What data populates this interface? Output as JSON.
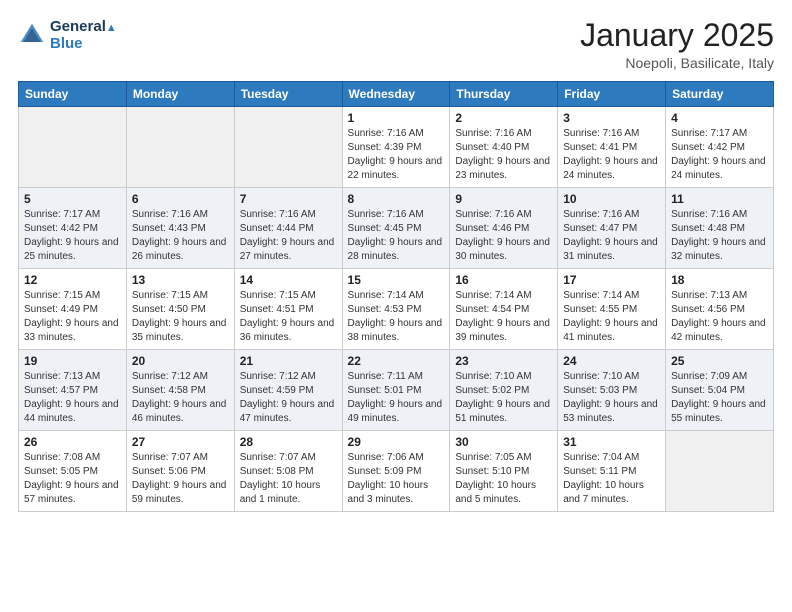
{
  "header": {
    "logo_line1": "General",
    "logo_line2": "Blue",
    "month_title": "January 2025",
    "location": "Noepoli, Basilicate, Italy"
  },
  "days_of_week": [
    "Sunday",
    "Monday",
    "Tuesday",
    "Wednesday",
    "Thursday",
    "Friday",
    "Saturday"
  ],
  "weeks": [
    [
      {
        "day": "",
        "info": ""
      },
      {
        "day": "",
        "info": ""
      },
      {
        "day": "",
        "info": ""
      },
      {
        "day": "1",
        "info": "Sunrise: 7:16 AM\nSunset: 4:39 PM\nDaylight: 9 hours and 22 minutes."
      },
      {
        "day": "2",
        "info": "Sunrise: 7:16 AM\nSunset: 4:40 PM\nDaylight: 9 hours and 23 minutes."
      },
      {
        "day": "3",
        "info": "Sunrise: 7:16 AM\nSunset: 4:41 PM\nDaylight: 9 hours and 24 minutes."
      },
      {
        "day": "4",
        "info": "Sunrise: 7:17 AM\nSunset: 4:42 PM\nDaylight: 9 hours and 24 minutes."
      }
    ],
    [
      {
        "day": "5",
        "info": "Sunrise: 7:17 AM\nSunset: 4:42 PM\nDaylight: 9 hours and 25 minutes."
      },
      {
        "day": "6",
        "info": "Sunrise: 7:16 AM\nSunset: 4:43 PM\nDaylight: 9 hours and 26 minutes."
      },
      {
        "day": "7",
        "info": "Sunrise: 7:16 AM\nSunset: 4:44 PM\nDaylight: 9 hours and 27 minutes."
      },
      {
        "day": "8",
        "info": "Sunrise: 7:16 AM\nSunset: 4:45 PM\nDaylight: 9 hours and 28 minutes."
      },
      {
        "day": "9",
        "info": "Sunrise: 7:16 AM\nSunset: 4:46 PM\nDaylight: 9 hours and 30 minutes."
      },
      {
        "day": "10",
        "info": "Sunrise: 7:16 AM\nSunset: 4:47 PM\nDaylight: 9 hours and 31 minutes."
      },
      {
        "day": "11",
        "info": "Sunrise: 7:16 AM\nSunset: 4:48 PM\nDaylight: 9 hours and 32 minutes."
      }
    ],
    [
      {
        "day": "12",
        "info": "Sunrise: 7:15 AM\nSunset: 4:49 PM\nDaylight: 9 hours and 33 minutes."
      },
      {
        "day": "13",
        "info": "Sunrise: 7:15 AM\nSunset: 4:50 PM\nDaylight: 9 hours and 35 minutes."
      },
      {
        "day": "14",
        "info": "Sunrise: 7:15 AM\nSunset: 4:51 PM\nDaylight: 9 hours and 36 minutes."
      },
      {
        "day": "15",
        "info": "Sunrise: 7:14 AM\nSunset: 4:53 PM\nDaylight: 9 hours and 38 minutes."
      },
      {
        "day": "16",
        "info": "Sunrise: 7:14 AM\nSunset: 4:54 PM\nDaylight: 9 hours and 39 minutes."
      },
      {
        "day": "17",
        "info": "Sunrise: 7:14 AM\nSunset: 4:55 PM\nDaylight: 9 hours and 41 minutes."
      },
      {
        "day": "18",
        "info": "Sunrise: 7:13 AM\nSunset: 4:56 PM\nDaylight: 9 hours and 42 minutes."
      }
    ],
    [
      {
        "day": "19",
        "info": "Sunrise: 7:13 AM\nSunset: 4:57 PM\nDaylight: 9 hours and 44 minutes."
      },
      {
        "day": "20",
        "info": "Sunrise: 7:12 AM\nSunset: 4:58 PM\nDaylight: 9 hours and 46 minutes."
      },
      {
        "day": "21",
        "info": "Sunrise: 7:12 AM\nSunset: 4:59 PM\nDaylight: 9 hours and 47 minutes."
      },
      {
        "day": "22",
        "info": "Sunrise: 7:11 AM\nSunset: 5:01 PM\nDaylight: 9 hours and 49 minutes."
      },
      {
        "day": "23",
        "info": "Sunrise: 7:10 AM\nSunset: 5:02 PM\nDaylight: 9 hours and 51 minutes."
      },
      {
        "day": "24",
        "info": "Sunrise: 7:10 AM\nSunset: 5:03 PM\nDaylight: 9 hours and 53 minutes."
      },
      {
        "day": "25",
        "info": "Sunrise: 7:09 AM\nSunset: 5:04 PM\nDaylight: 9 hours and 55 minutes."
      }
    ],
    [
      {
        "day": "26",
        "info": "Sunrise: 7:08 AM\nSunset: 5:05 PM\nDaylight: 9 hours and 57 minutes."
      },
      {
        "day": "27",
        "info": "Sunrise: 7:07 AM\nSunset: 5:06 PM\nDaylight: 9 hours and 59 minutes."
      },
      {
        "day": "28",
        "info": "Sunrise: 7:07 AM\nSunset: 5:08 PM\nDaylight: 10 hours and 1 minute."
      },
      {
        "day": "29",
        "info": "Sunrise: 7:06 AM\nSunset: 5:09 PM\nDaylight: 10 hours and 3 minutes."
      },
      {
        "day": "30",
        "info": "Sunrise: 7:05 AM\nSunset: 5:10 PM\nDaylight: 10 hours and 5 minutes."
      },
      {
        "day": "31",
        "info": "Sunrise: 7:04 AM\nSunset: 5:11 PM\nDaylight: 10 hours and 7 minutes."
      },
      {
        "day": "",
        "info": ""
      }
    ]
  ]
}
